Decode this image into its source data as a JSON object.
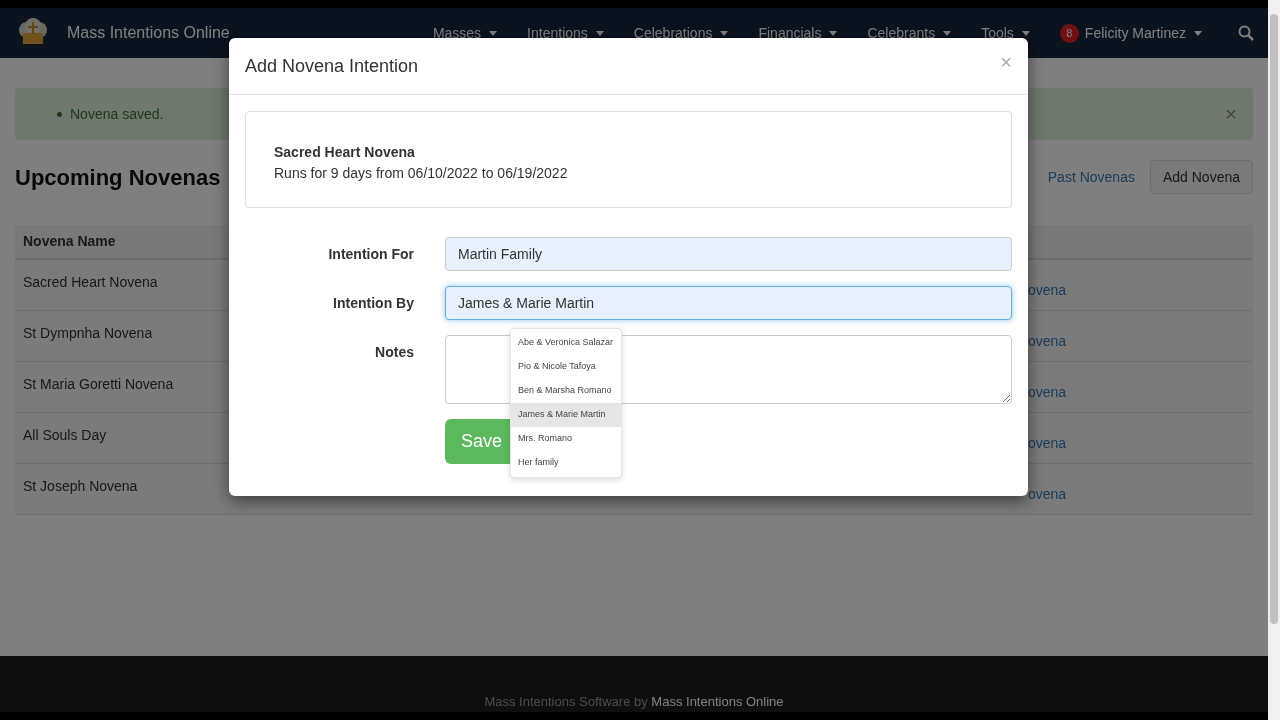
{
  "navbar": {
    "brand": "Mass Intentions Online",
    "menus": [
      {
        "label": "Masses"
      },
      {
        "label": "Intentions"
      },
      {
        "label": "Celebrations"
      },
      {
        "label": "Financials"
      },
      {
        "label": "Celebrants"
      },
      {
        "label": "Tools"
      }
    ],
    "user": {
      "badge": "8",
      "name": "Felicity Martinez"
    }
  },
  "alert": {
    "messages": [
      "Novena saved."
    ],
    "close": "×"
  },
  "page": {
    "title": "Upcoming Novenas",
    "past_link": "Past Novenas",
    "add_button": "Add Novena"
  },
  "table": {
    "columns": [
      "Novena Name"
    ],
    "rows": [
      {
        "name": "Sacred Heart Novena",
        "link": "ovena"
      },
      {
        "name": "St Dympnha Novena",
        "link": "ovena"
      },
      {
        "name": "St Maria Goretti Novena",
        "link": "ovena"
      },
      {
        "name": "All Souls Day",
        "link": "ovena"
      },
      {
        "name": "St Joseph Novena",
        "link": "ovena"
      }
    ]
  },
  "modal": {
    "title": "Add Novena Intention",
    "close": "×",
    "novena": {
      "name": "Sacred Heart Novena",
      "summary": "Runs for 9 days from 06/10/2022 to 06/19/2022"
    },
    "fields": [
      {
        "kind": "input",
        "label": "Intention For",
        "value": "Martin Family",
        "focused": false
      },
      {
        "kind": "input",
        "label": "Intention By",
        "value": "James & Marie Martin",
        "focused": true
      },
      {
        "kind": "textarea",
        "label": "Notes",
        "focused": false
      }
    ],
    "save_button": "Save",
    "suggestions": [
      {
        "label": "Abe & Veronica Salazar",
        "selected": false
      },
      {
        "label": "Pio & Nicole Tafoya",
        "selected": false
      },
      {
        "label": "Ben & Marsha Romano",
        "selected": false
      },
      {
        "label": "James & Marie Martin",
        "selected": true
      },
      {
        "label": "Mrs. Romano",
        "selected": false
      },
      {
        "label": "Her family",
        "selected": false
      }
    ]
  },
  "footer": {
    "text": "Mass Intentions Software by",
    "link": "Mass Intentions Online"
  }
}
